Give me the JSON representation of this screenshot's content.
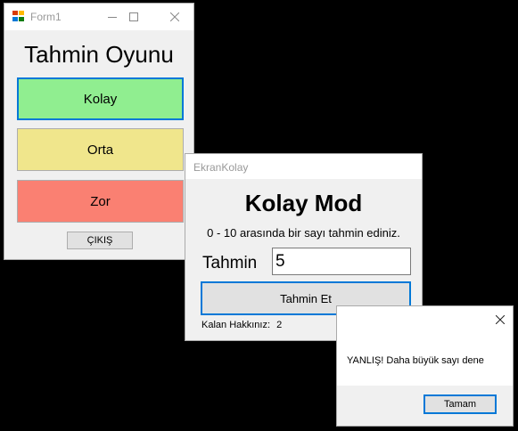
{
  "form1": {
    "title": "Form1",
    "heading": "Tahmin Oyunu",
    "buttons": {
      "easy": "Kolay",
      "medium": "Orta",
      "hard": "Zor",
      "exit": "ÇIKIŞ"
    },
    "colors": {
      "easy": "#90ee90",
      "medium": "#f0e68c",
      "hard": "#fa8072",
      "focus_border": "#0078d7"
    },
    "icons": [
      "form-app-icon",
      "minimize-icon",
      "maximize-icon",
      "close-icon"
    ]
  },
  "ekran": {
    "title": "EkranKolay",
    "heading": "Kolay Mod",
    "instruction": "0 - 10 arasında bir sayı tahmin ediniz.",
    "guess_label": "Tahmin",
    "guess_value": "5",
    "guess_button": "Tahmin Et",
    "remaining_label": "Kalan Hakkınız:",
    "remaining_value": "2"
  },
  "message_box": {
    "text": "YANLIŞ! Daha büyük sayı dene",
    "ok_button": "Tamam",
    "icons": [
      "close-icon"
    ]
  }
}
